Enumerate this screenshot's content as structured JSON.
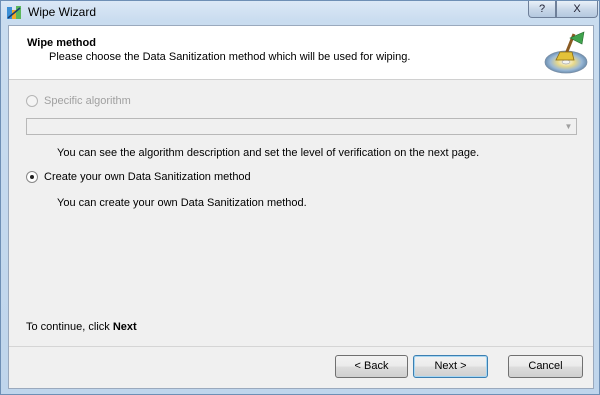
{
  "window": {
    "title": "Wipe Wizard",
    "help_label": "?",
    "close_label": "X",
    "app_icon": "wizard-icon"
  },
  "header": {
    "title": "Wipe method",
    "subtitle": "Please choose the Data Sanitization method which will be used for wiping.",
    "icon": "disc-broom-icon"
  },
  "options": {
    "specific": {
      "label": "Specific algorithm",
      "enabled": false,
      "selected": false,
      "combo_value": "",
      "description": "You can see the algorithm description and set the level of verification on the next page."
    },
    "custom": {
      "label": "Create your own Data Sanitization method",
      "enabled": true,
      "selected": true,
      "description": "You can create your own Data Sanitization method."
    }
  },
  "footer": {
    "continue_prefix": "To continue, click ",
    "continue_action": "Next",
    "back_label": "< Back",
    "next_label": "Next >",
    "cancel_label": "Cancel"
  }
}
